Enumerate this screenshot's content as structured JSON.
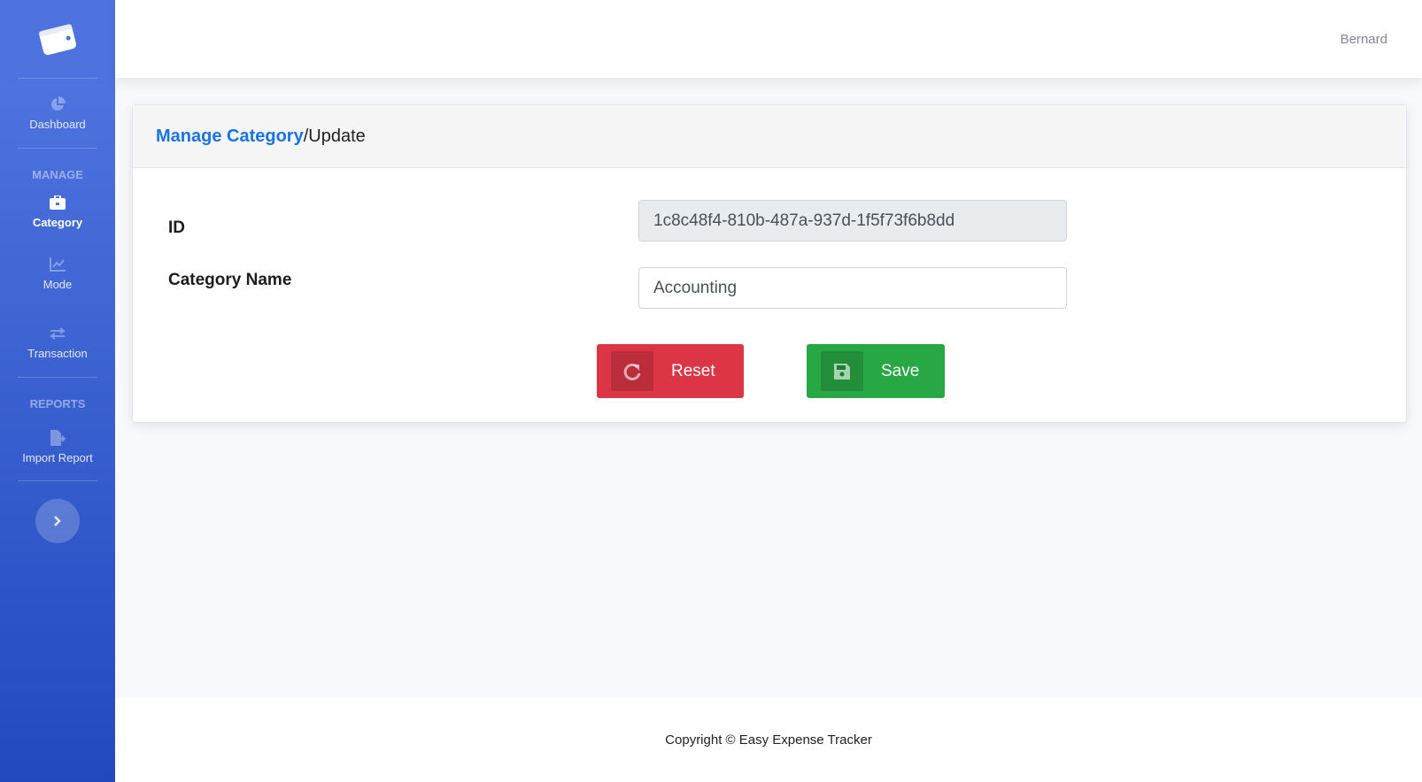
{
  "app": {
    "brand_icon": "wallet-icon",
    "user_name": "Bernard"
  },
  "sidebar": {
    "items": [
      {
        "label": "Dashboard",
        "icon": "chart-pie-icon"
      },
      {
        "label": "Category",
        "icon": "briefcase-icon"
      },
      {
        "label": "Mode",
        "icon": "chart-line-icon"
      },
      {
        "label": "Transaction",
        "icon": "exchange-icon"
      },
      {
        "label": "Import Report",
        "icon": "file-export-icon"
      }
    ],
    "headings": {
      "manage": "Manage",
      "reports": "Reports"
    },
    "active": "Category",
    "toggle_icon": "chevron-right-icon"
  },
  "breadcrumb": {
    "link": "Manage Category",
    "separator": "/",
    "current": "Update"
  },
  "form": {
    "id_label": "ID",
    "id_value": "1c8c48f4-810b-487a-937d-1f5f73f6b8dd",
    "name_label": "Category Name",
    "name_value": "Accounting"
  },
  "buttons": {
    "reset": "Reset",
    "save": "Save"
  },
  "colors": {
    "sidebar_start": "#4e73df",
    "sidebar_end": "#224abe",
    "link": "#1a73e8",
    "danger": "#dc3545",
    "success": "#28a745"
  },
  "footer": {
    "text": "Copyright © Easy Expense Tracker"
  }
}
